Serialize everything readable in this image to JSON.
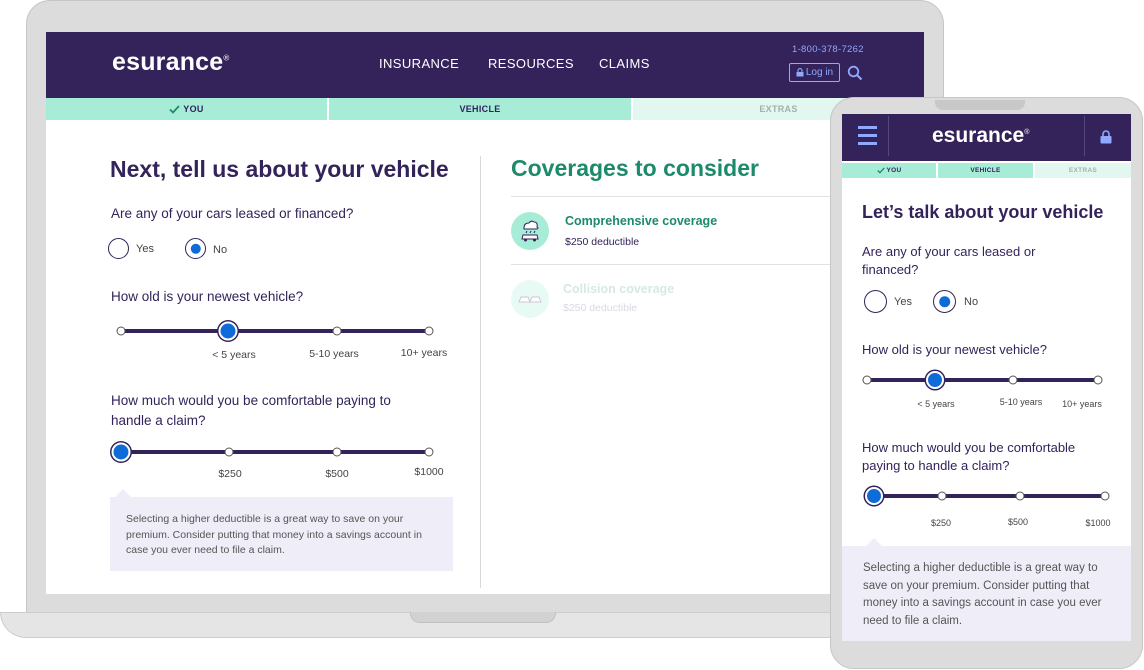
{
  "desktop": {
    "brand": "esurance",
    "brand_mark": "®",
    "nav": {
      "items": [
        "INSURANCE",
        "RESOURCES",
        "CLAIMS"
      ],
      "phone": "1-800-378-7262",
      "login": "Log in"
    },
    "steps": [
      {
        "label": "YOU",
        "state": "done"
      },
      {
        "label": "VEHICLE",
        "state": "active"
      },
      {
        "label": "EXTRAS",
        "state": "todo"
      }
    ],
    "heading": "Next, tell us about your vehicle",
    "q_leased": "Are any of your cars leased or financed?",
    "radio_yes": "Yes",
    "radio_no": "No",
    "q_age": "How old is your newest vehicle?",
    "age_ticks": [
      "< 5 years",
      "5-10 years",
      "10+ years"
    ],
    "q_deductible": "How much would you be comfortable paying to handle a claim?",
    "deductible_ticks": [
      "$250",
      "$500",
      "$1000"
    ],
    "tip": "Selecting a higher deductible is a great way to save on your premium. Consider putting that money into a savings account in case you ever need to file a claim.",
    "coverages_heading": "Coverages to consider",
    "coverages": [
      {
        "title": "Comprehensive coverage",
        "sub": "$250 deductible"
      },
      {
        "title": "Collision coverage",
        "sub": "$250 deductible"
      }
    ]
  },
  "mobile": {
    "brand": "esurance",
    "brand_mark": "®",
    "steps": [
      {
        "label": "YOU",
        "state": "done"
      },
      {
        "label": "VEHICLE",
        "state": "active"
      },
      {
        "label": "EXTRAS",
        "state": "todo"
      }
    ],
    "heading": "Let’s talk about your vehicle",
    "q_leased": "Are any of your cars leased or financed?",
    "radio_yes": "Yes",
    "radio_no": "No",
    "q_age": "How old is your newest vehicle?",
    "age_ticks": [
      "< 5 years",
      "5-10 years",
      "10+ years"
    ],
    "q_deductible": "How much would you be comfortable paying to handle a claim?",
    "deductible_ticks": [
      "$250",
      "$500",
      "$1000"
    ],
    "tip": "Selecting a higher deductible is a great way to save on your premium. Consider putting that money into a savings account in case you ever need to file a claim."
  },
  "colors": {
    "brand_purple": "#33235a",
    "accent_blue": "#0e6bd8",
    "mint": "#a6ecd7",
    "green": "#1c8a6b",
    "link_blue": "#8fa9ff"
  },
  "selection": {
    "leased": "No",
    "vehicle_age": "< 5 years",
    "deductible": "lowest (left-most stop)"
  }
}
